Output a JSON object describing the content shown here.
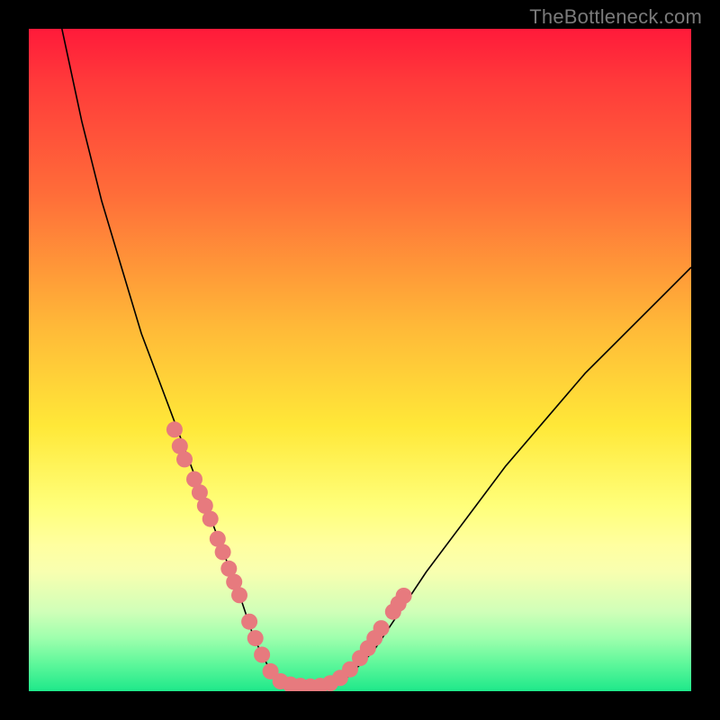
{
  "watermark": "TheBottleneck.com",
  "chart_data": {
    "type": "line",
    "title": "",
    "xlabel": "",
    "ylabel": "",
    "xlim": [
      0,
      100
    ],
    "ylim": [
      0,
      100
    ],
    "series": [
      {
        "name": "curve",
        "x": [
          5,
          8,
          11,
          14,
          17,
          20,
          23,
          26,
          29,
          32,
          34,
          36,
          37,
          38,
          40,
          44,
          48,
          52,
          56,
          60,
          66,
          72,
          78,
          84,
          90,
          96,
          100
        ],
        "y": [
          100,
          86,
          74,
          64,
          54,
          46,
          38,
          30,
          22,
          14,
          8,
          4,
          2,
          1,
          0.5,
          0.5,
          2,
          6,
          12,
          18,
          26,
          34,
          41,
          48,
          54,
          60,
          64
        ]
      }
    ],
    "markers": [
      {
        "x": 22.0,
        "y": 39.5
      },
      {
        "x": 22.8,
        "y": 37.0
      },
      {
        "x": 23.5,
        "y": 35.0
      },
      {
        "x": 25.0,
        "y": 32.0
      },
      {
        "x": 25.8,
        "y": 30.0
      },
      {
        "x": 26.6,
        "y": 28.0
      },
      {
        "x": 27.4,
        "y": 26.0
      },
      {
        "x": 28.5,
        "y": 23.0
      },
      {
        "x": 29.3,
        "y": 21.0
      },
      {
        "x": 30.2,
        "y": 18.5
      },
      {
        "x": 31.0,
        "y": 16.5
      },
      {
        "x": 31.8,
        "y": 14.5
      },
      {
        "x": 33.3,
        "y": 10.5
      },
      {
        "x": 34.2,
        "y": 8.0
      },
      {
        "x": 35.2,
        "y": 5.5
      },
      {
        "x": 36.5,
        "y": 3.0
      },
      {
        "x": 38.0,
        "y": 1.5
      },
      {
        "x": 39.5,
        "y": 1.0
      },
      {
        "x": 41.0,
        "y": 0.8
      },
      {
        "x": 42.5,
        "y": 0.7
      },
      {
        "x": 44.0,
        "y": 0.8
      },
      {
        "x": 45.5,
        "y": 1.2
      },
      {
        "x": 47.0,
        "y": 2.0
      },
      {
        "x": 48.5,
        "y": 3.3
      },
      {
        "x": 50.0,
        "y": 5.0
      },
      {
        "x": 51.2,
        "y": 6.5
      },
      {
        "x": 52.2,
        "y": 8.0
      },
      {
        "x": 53.2,
        "y": 9.5
      },
      {
        "x": 55.0,
        "y": 12.0
      },
      {
        "x": 55.8,
        "y": 13.2
      },
      {
        "x": 56.6,
        "y": 14.4
      }
    ],
    "marker_color": "#e77a7e",
    "marker_radius_px": 9
  }
}
